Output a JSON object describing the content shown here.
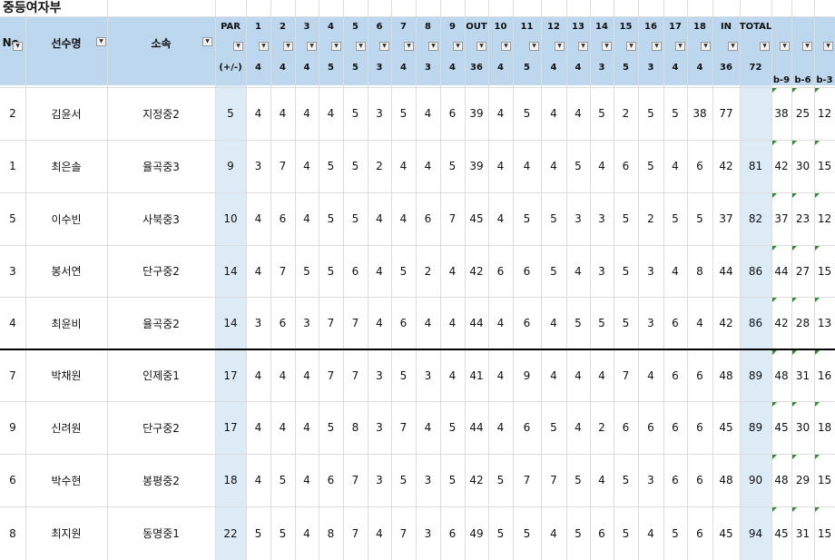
{
  "title": "중등여자부",
  "header": {
    "no": "No.",
    "name": "선수명",
    "team": "소속",
    "par": "PAR",
    "par_sub": "(+/-)",
    "holes": [
      "1",
      "2",
      "3",
      "4",
      "5",
      "6",
      "7",
      "8",
      "9",
      "OUT",
      "10",
      "11",
      "12",
      "13",
      "14",
      "15",
      "16",
      "17",
      "18",
      "IN",
      "TOTAL"
    ],
    "hole_pars": [
      "4",
      "4",
      "4",
      "5",
      "5",
      "3",
      "4",
      "3",
      "4",
      "36",
      "4",
      "5",
      "4",
      "4",
      "3",
      "5",
      "3",
      "4",
      "4",
      "36",
      "72"
    ],
    "back": [
      "b-9",
      "b-6",
      "b-3"
    ]
  },
  "rows": [
    {
      "no": "2",
      "name": "김윤서",
      "team": "지정중2",
      "par": "5",
      "scores": [
        "4",
        "4",
        "4",
        "4",
        "5",
        "3",
        "5",
        "4",
        "6",
        "39",
        "4",
        "5",
        "4",
        "4",
        "5",
        "2",
        "5",
        "5",
        "38",
        "77"
      ],
      "back": [
        "38",
        "25",
        "12"
      ]
    },
    {
      "no": "1",
      "name": "최은솔",
      "team": "율곡중3",
      "par": "9",
      "scores": [
        "3",
        "7",
        "4",
        "5",
        "5",
        "2",
        "4",
        "4",
        "5",
        "39",
        "4",
        "4",
        "4",
        "5",
        "4",
        "6",
        "5",
        "4",
        "6",
        "42",
        "81"
      ],
      "back": [
        "42",
        "30",
        "15"
      ]
    },
    {
      "no": "5",
      "name": "이수빈",
      "team": "사북중3",
      "par": "10",
      "scores": [
        "4",
        "6",
        "4",
        "5",
        "5",
        "4",
        "4",
        "6",
        "7",
        "45",
        "4",
        "5",
        "5",
        "3",
        "3",
        "5",
        "2",
        "5",
        "5",
        "37",
        "82"
      ],
      "back": [
        "37",
        "23",
        "12"
      ]
    },
    {
      "no": "3",
      "name": "봉서연",
      "team": "단구중2",
      "par": "14",
      "scores": [
        "4",
        "7",
        "5",
        "5",
        "6",
        "4",
        "5",
        "2",
        "4",
        "42",
        "6",
        "6",
        "5",
        "4",
        "3",
        "5",
        "3",
        "4",
        "8",
        "44",
        "86"
      ],
      "back": [
        "44",
        "27",
        "15"
      ]
    },
    {
      "no": "4",
      "name": "최윤비",
      "team": "율곡중2",
      "par": "14",
      "scores": [
        "3",
        "6",
        "3",
        "7",
        "7",
        "4",
        "6",
        "4",
        "4",
        "44",
        "4",
        "6",
        "4",
        "5",
        "5",
        "5",
        "3",
        "6",
        "4",
        "42",
        "86"
      ],
      "back": [
        "42",
        "28",
        "13"
      ]
    },
    {
      "no": "7",
      "name": "박채원",
      "team": "인제중1",
      "par": "17",
      "scores": [
        "4",
        "4",
        "4",
        "7",
        "7",
        "3",
        "5",
        "3",
        "4",
        "41",
        "4",
        "9",
        "4",
        "4",
        "4",
        "7",
        "4",
        "6",
        "6",
        "48",
        "89"
      ],
      "back": [
        "48",
        "31",
        "16"
      ]
    },
    {
      "no": "9",
      "name": "신려원",
      "team": "단구중2",
      "par": "17",
      "scores": [
        "4",
        "4",
        "4",
        "5",
        "8",
        "3",
        "7",
        "4",
        "5",
        "44",
        "4",
        "6",
        "5",
        "4",
        "2",
        "6",
        "6",
        "6",
        "6",
        "45",
        "89"
      ],
      "back": [
        "45",
        "30",
        "18"
      ]
    },
    {
      "no": "6",
      "name": "박수현",
      "team": "봉평중2",
      "par": "18",
      "scores": [
        "4",
        "5",
        "4",
        "6",
        "7",
        "3",
        "5",
        "3",
        "5",
        "42",
        "5",
        "7",
        "7",
        "5",
        "4",
        "5",
        "3",
        "6",
        "6",
        "48",
        "90"
      ],
      "back": [
        "48",
        "29",
        "15"
      ]
    },
    {
      "no": "8",
      "name": "최지원",
      "team": "동명중1",
      "par": "22",
      "scores": [
        "5",
        "5",
        "4",
        "8",
        "7",
        "4",
        "7",
        "3",
        "6",
        "49",
        "5",
        "5",
        "4",
        "5",
        "6",
        "5",
        "4",
        "5",
        "6",
        "45",
        "94"
      ],
      "back": [
        "45",
        "31",
        "15"
      ]
    }
  ]
}
